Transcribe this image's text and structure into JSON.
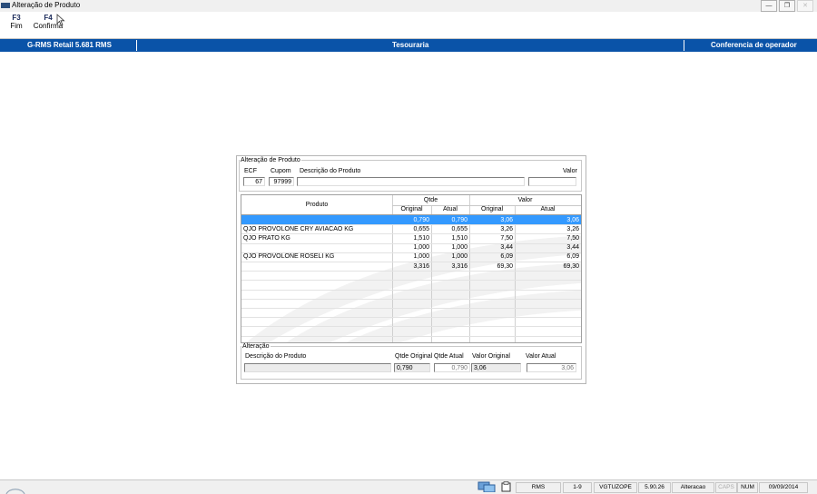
{
  "window": {
    "title": "Alteração de Produto"
  },
  "toolbar": [
    {
      "key": "F3",
      "label": "Fim"
    },
    {
      "key": "F4",
      "label": "Confirma"
    }
  ],
  "header": {
    "left": "G-RMS Retail 5.681 RMS",
    "center": "Tesouraria",
    "right": "Conferencia de operador"
  },
  "form": {
    "group_title": "Alteração de Produto",
    "ecf_label": "ECF",
    "ecf_value": "67",
    "cupom_label": "Cupom",
    "cupom_value": "97999",
    "desc_label": "Descrição do Produto",
    "desc_value": "",
    "valor_label": "Valor",
    "valor_value": ""
  },
  "grid": {
    "col_produto": "Produto",
    "group_qtde": "Qtde",
    "group_valor": "Valor",
    "sub_original": "Original",
    "sub_atual": "Atual",
    "rows": [
      {
        "produto": "",
        "qtde_original": "0,790",
        "qtde_atual": "0,790",
        "valor_original": "3,06",
        "valor_atual": "3,06",
        "selected": true
      },
      {
        "produto": "QJO PROVOLONE CRY AVIACAO KG",
        "qtde_original": "0,655",
        "qtde_atual": "0,655",
        "valor_original": "3,26",
        "valor_atual": "3,26"
      },
      {
        "produto": "QJO PRATO KG",
        "qtde_original": "1,510",
        "qtde_atual": "1,510",
        "valor_original": "7,50",
        "valor_atual": "7,50"
      },
      {
        "produto": "",
        "qtde_original": "1,000",
        "qtde_atual": "1,000",
        "valor_original": "3,44",
        "valor_atual": "3,44"
      },
      {
        "produto": "QJO PROVOLONE ROSELI KG",
        "qtde_original": "1,000",
        "qtde_atual": "1,000",
        "valor_original": "6,09",
        "valor_atual": "6,09"
      },
      {
        "produto": "",
        "qtde_original": "3,316",
        "qtde_atual": "3,316",
        "valor_original": "69,30",
        "valor_atual": "69,30"
      }
    ],
    "selected_color": "#3399ff"
  },
  "alteracao": {
    "group_title": "Alteração",
    "desc_label": "Descrição do Produto",
    "desc_value": "",
    "qtde_original_label": "Qtde Original",
    "qtde_original_value": "0,790",
    "qtde_atual_label": "Qtde Atual",
    "qtde_atual_value": "0,790",
    "valor_original_label": "Valor Original",
    "valor_original_value": "3,06",
    "valor_atual_label": "Valor Atual",
    "valor_atual_value": "3,06"
  },
  "statusbar": {
    "app": "RMS",
    "range": "1-9",
    "user": "VGTUZOPE",
    "version": "5.90.26",
    "mode": "Alteracao",
    "caps": "CAPS",
    "num": "NUM",
    "date": "09/09/2014"
  },
  "colors": {
    "header_bg": "#0a53a8",
    "accent": "#3399ff"
  }
}
